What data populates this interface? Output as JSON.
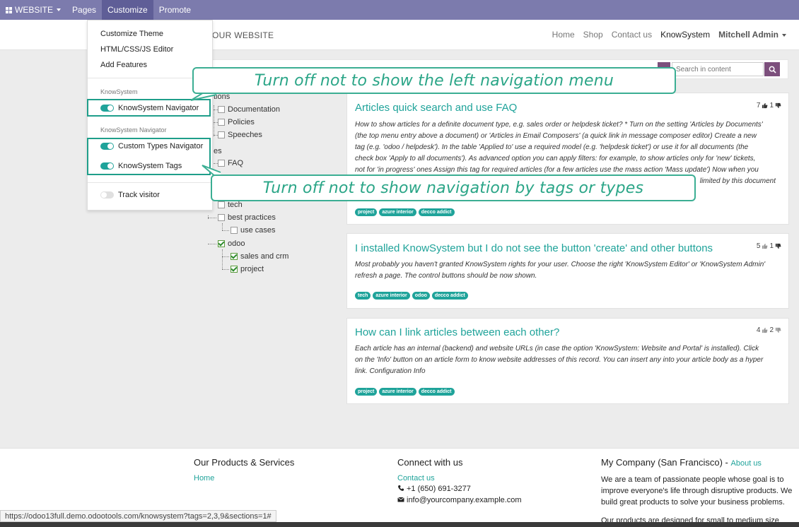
{
  "topbar": {
    "website": "WEBSITE",
    "pages": "Pages",
    "customize": "Customize",
    "promote": "Promote"
  },
  "header": {
    "brand": "OUR WEBSITE",
    "nav": [
      "Home",
      "Shop",
      "Contact us",
      "KnowSystem"
    ],
    "user": "Mitchell Admin"
  },
  "search": {
    "placeholder": "Search in content"
  },
  "dropdown": {
    "customize_theme": "Customize Theme",
    "editor": "HTML/CSS/JS Editor",
    "add_features": "Add Features",
    "section_knowsystem": "KnowSystem",
    "knowsystem_navigator": "KnowSystem Navigator",
    "section_navigator": "KnowSystem Navigator",
    "custom_types": "Custom Types Navigator",
    "knowsystem_tags": "KnowSystem Tags",
    "track_visitor": "Track visitor"
  },
  "callouts": {
    "left_menu": "Turn off not to show the left navigation menu",
    "tags_types": "Turn off not to show navigation by tags or types"
  },
  "tree": {
    "section1_title": "tions",
    "section1_items": [
      "Documentation",
      "Policies",
      "Speeches"
    ],
    "section2_title": "es",
    "section2_items": [
      "FAQ"
    ],
    "tags": [
      "tech",
      "best practices",
      "use cases",
      "odoo",
      "sales and crm",
      "project"
    ]
  },
  "articles": [
    {
      "title": "Articles quick search and use FAQ",
      "up": "7",
      "down": "1",
      "text_lines": [
        "How to show articles for a definite document type, e.g. sales order or helpdesk ticket? * Turn on the setting 'Articles by Documents'",
        "(the top menu entry above a document) or 'Articles in Email Composers' (a quick link in message composer editor) Create a new",
        "tag (e.g. 'odoo / helpdesk'). In the table 'Applied to' use a required model (e.g. 'helpdesk ticket') or use it for all documents (the",
        "check box 'Apply to all documents'). As advanced option you can apply filters: for example, to show articles only for 'new' tickets,",
        "not for 'in progress' ones Assign this tag for required articles (for a few articles use the mass action 'Mass update') Now when you",
        "limited by this document"
      ],
      "tags": [
        "project",
        "azure interior",
        "decco addict"
      ]
    },
    {
      "title": "I installed KnowSystem but I do not see the button 'create' and other buttons",
      "up": "5",
      "down": "1",
      "text_lines": [
        "Most probably you haven't granted KnowSystem rights for your user. Choose the right 'KnowSystem Editor' or 'KnowSystem Admin'",
        "refresh a page. The control buttons should be now shown."
      ],
      "tags": [
        "tech",
        "azure interior",
        "odoo",
        "decco addict"
      ]
    },
    {
      "title": "How can I link articles between each other?",
      "up": "4",
      "down": "2",
      "text_lines": [
        "Each article has an internal (backend) and website URLs (in case the option 'KnowSystem: Website and Portal' is installed). Click",
        "on the 'Info' button on an article form to know website addresses of this record. You can insert any into your article body as a hyper",
        "link. Configuration Info"
      ],
      "tags": [
        "project",
        "azure interior",
        "decco addict"
      ]
    }
  ],
  "footer": {
    "col1_title": "Our Products & Services",
    "col1_link": "Home",
    "col2_title": "Connect with us",
    "col2_link": "Contact us",
    "phone": "+1 (650) 691-3277",
    "email": "info@yourcompany.example.com",
    "col3_title": "My Company (San Francisco) -",
    "col3_link": "About us",
    "col3_lines": [
      "We are a team of passionate people whose goal is to",
      "improve everyone's life through disruptive products. We",
      "build great products to solve your business problems.",
      "Our products are designed for small to medium size"
    ]
  },
  "statusbar": "https://odoo13full.demo.odootools.com/knowsystem?tags=2,3,9&sections=1#",
  "colors": {
    "admin_bar": "#7c7bad",
    "accent": "#1fa39a",
    "callout_border": "#3bae93",
    "search_button": "#7c4f7c"
  }
}
